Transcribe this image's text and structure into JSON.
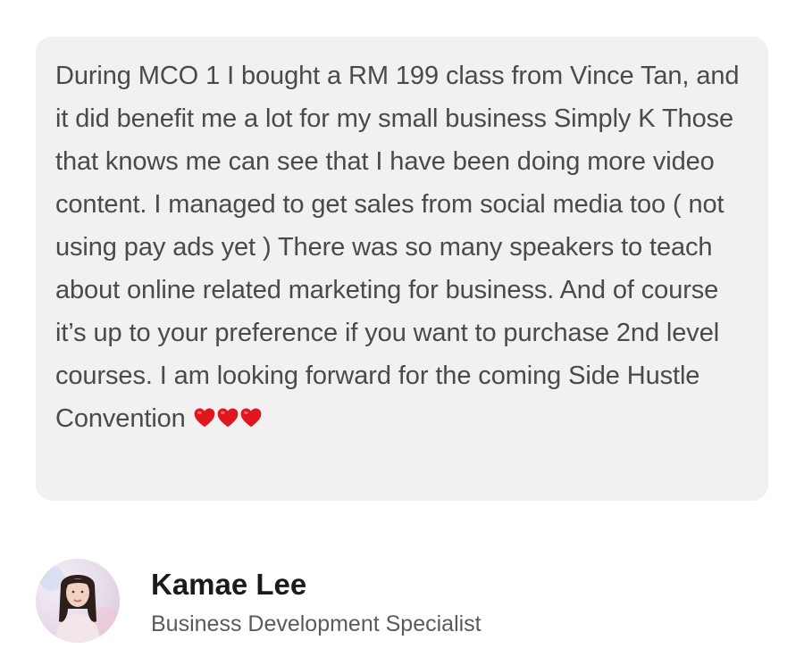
{
  "testimonial": {
    "text": "During MCO 1 I bought a RM 199 class from Vince Tan, and it did benefit me a lot for my small business Simply K Those that knows me can see that I have been doing more video content. I managed to get sales from social media too ( not using pay ads yet ) There was so many speakers to teach about online related marketing for business. And of course it’s up to your preference if you want to purchase 2nd level courses. I am looking forward for the coming Side Hustle Convention",
    "emoji": [
      "heart-icon",
      "heart-icon",
      "heart-icon"
    ],
    "heart_color": "#e0161e",
    "bubble_color": "#f1f1f1"
  },
  "author": {
    "name": "Kamae Lee",
    "title": "Business Development Specialist",
    "avatar_icon": "profile-photo"
  }
}
